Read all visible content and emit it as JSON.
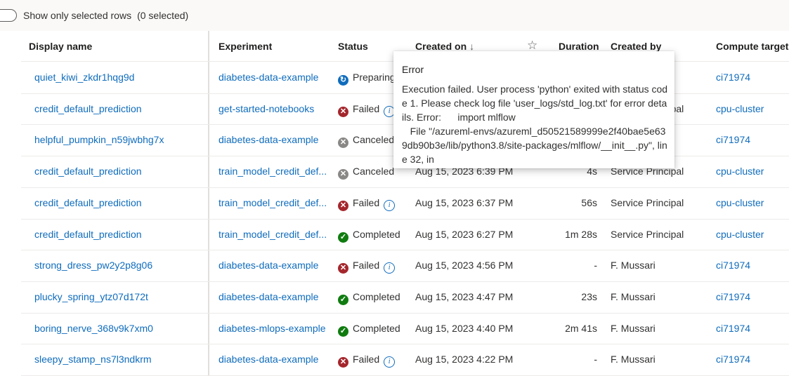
{
  "toolbar": {
    "toggle_label": "Show only selected rows",
    "selected_count": "(0 selected)"
  },
  "headers": {
    "display_name": "Display name",
    "experiment": "Experiment",
    "status": "Status",
    "created_on": "Created on",
    "created_on_sort": "↓",
    "duration": "Duration",
    "created_by": "Created by",
    "compute_target": "Compute target"
  },
  "rows": [
    {
      "name": "quiet_kiwi_zkdr1hqg9d",
      "experiment": "diabetes-data-example",
      "status": "Preparing",
      "status_kind": "preparing",
      "info": false,
      "created_on": "",
      "duration": "",
      "created_by": "",
      "compute": "ci71974"
    },
    {
      "name": "credit_default_prediction",
      "experiment": "get-started-notebooks",
      "status": "Failed",
      "status_kind": "failed",
      "info": true,
      "created_on": "",
      "duration": "",
      "created_by": "Service Principal",
      "compute": "cpu-cluster"
    },
    {
      "name": "helpful_pumpkin_n59jwbhg7x",
      "experiment": "diabetes-data-example",
      "status": "Canceled",
      "status_kind": "canceled",
      "info": false,
      "created_on": "",
      "duration": "",
      "created_by": "",
      "compute": "ci71974"
    },
    {
      "name": "credit_default_prediction",
      "experiment": "train_model_credit_def...",
      "status": "Canceled",
      "status_kind": "canceled",
      "info": false,
      "created_on": "Aug 15, 2023 6:39 PM",
      "duration": "4s",
      "created_by": "Service Principal",
      "compute": "cpu-cluster"
    },
    {
      "name": "credit_default_prediction",
      "experiment": "train_model_credit_def...",
      "status": "Failed",
      "status_kind": "failed",
      "info": true,
      "created_on": "Aug 15, 2023 6:37 PM",
      "duration": "56s",
      "created_by": "Service Principal",
      "compute": "cpu-cluster"
    },
    {
      "name": "credit_default_prediction",
      "experiment": "train_model_credit_def...",
      "status": "Completed",
      "status_kind": "completed",
      "info": false,
      "created_on": "Aug 15, 2023 6:27 PM",
      "duration": "1m 28s",
      "created_by": "Service Principal",
      "compute": "cpu-cluster"
    },
    {
      "name": "strong_dress_pw2y2p8g06",
      "experiment": "diabetes-data-example",
      "status": "Failed",
      "status_kind": "failed",
      "info": true,
      "created_on": "Aug 15, 2023 4:56 PM",
      "duration": "-",
      "created_by": "F. Mussari",
      "compute": "ci71974"
    },
    {
      "name": "plucky_spring_ytz07d172t",
      "experiment": "diabetes-data-example",
      "status": "Completed",
      "status_kind": "completed",
      "info": false,
      "created_on": "Aug 15, 2023 4:47 PM",
      "duration": "23s",
      "created_by": "F. Mussari",
      "compute": "ci71974"
    },
    {
      "name": "boring_nerve_368v9k7xm0",
      "experiment": "diabetes-mlops-example",
      "status": "Completed",
      "status_kind": "completed",
      "info": false,
      "created_on": "Aug 15, 2023 4:40 PM",
      "duration": "2m 41s",
      "created_by": "F. Mussari",
      "compute": "ci71974"
    },
    {
      "name": "sleepy_stamp_ns7l3ndkrm",
      "experiment": "diabetes-data-example",
      "status": "Failed",
      "status_kind": "failed",
      "info": true,
      "created_on": "Aug 15, 2023 4:22 PM",
      "duration": "-",
      "created_by": "F. Mussari",
      "compute": "ci71974"
    }
  ],
  "tooltip": {
    "title": "Error",
    "body": "Execution failed. User process 'python' exited with status code 1. Please check log file 'user_logs/std_log.txt' for error details. Error:      import mlflow\n   File \"/azureml-envs/azureml_d50521589999e2f40bae5e639db90b3e/lib/python3.8/site-packages/mlflow/__init__.py\", line 32, in"
  },
  "colors": {
    "link": "#0f6cbd",
    "failed": "#a4262c",
    "completed": "#107c10",
    "canceled": "#8a8886"
  }
}
